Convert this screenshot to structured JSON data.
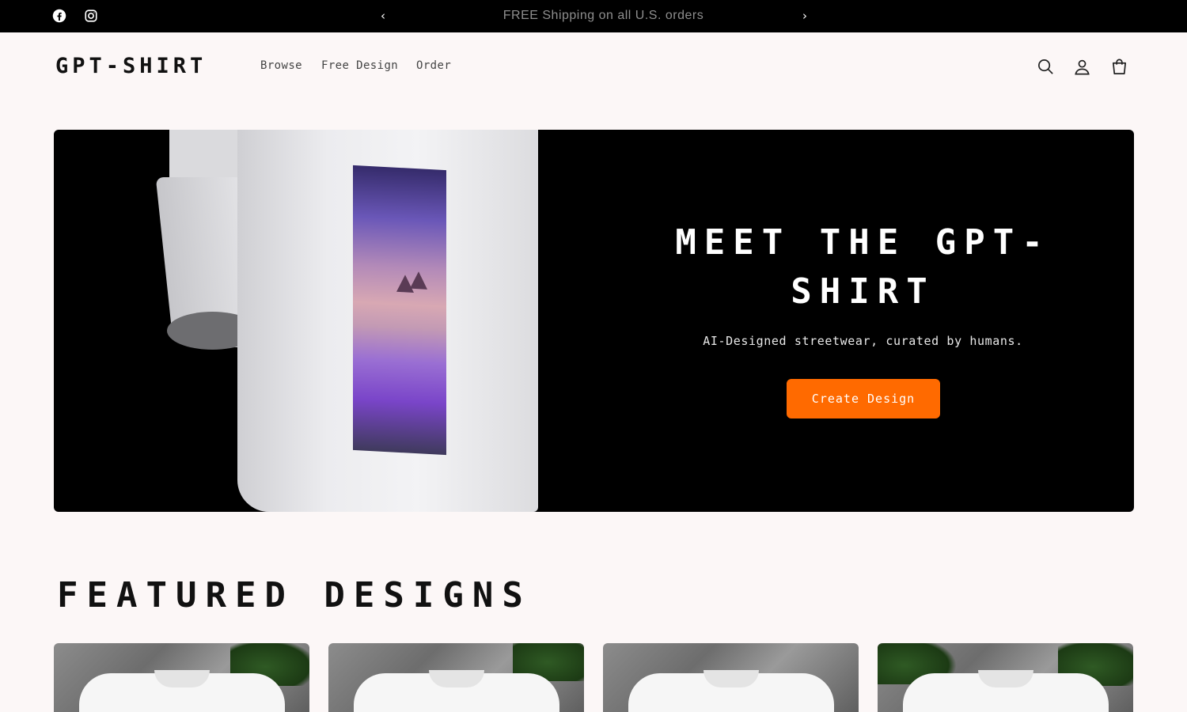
{
  "announcement": {
    "text": "FREE Shipping on all U.S. orders",
    "prev_icon": "chevron-left-icon",
    "next_icon": "chevron-right-icon",
    "social": [
      "facebook-icon",
      "instagram-icon"
    ]
  },
  "header": {
    "logo": "GPT-SHIRT",
    "nav": [
      "Browse",
      "Free Design",
      "Order"
    ],
    "icons": [
      "search-icon",
      "account-icon",
      "cart-icon"
    ]
  },
  "hero": {
    "title": "MEET THE GPT-SHIRT",
    "subtitle": "AI-Designed streetwear, curated by humans.",
    "cta_label": "Create Design",
    "cta_color": "#ff6a00"
  },
  "featured": {
    "title": "FEATURED DESIGNS",
    "cards": [
      {},
      {},
      {},
      {}
    ]
  }
}
